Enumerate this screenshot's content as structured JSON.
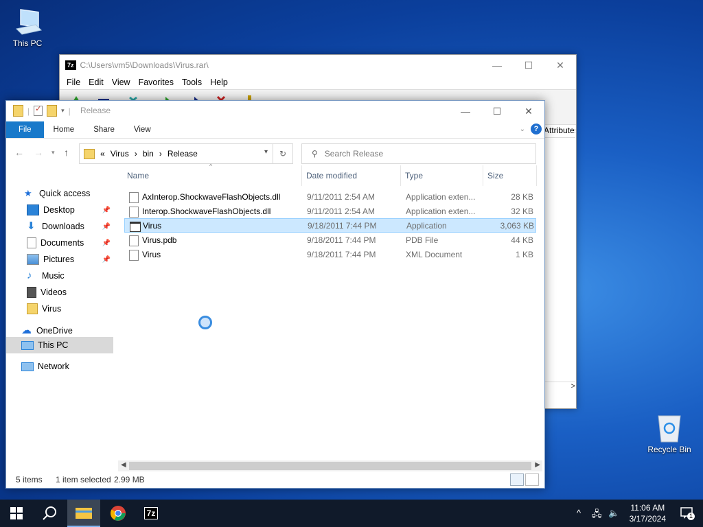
{
  "desktop": {
    "this_pc_label": "This PC",
    "recycle_bin_label": "Recycle Bin"
  },
  "sevenzip": {
    "path": "C:\\Users\\vm5\\Downloads\\Virus.rar\\",
    "logo": "7z",
    "menu": [
      "File",
      "Edit",
      "View",
      "Favorites",
      "Tools",
      "Help"
    ],
    "attr_header": "Attributes",
    "scroll_right": ">"
  },
  "explorer": {
    "title": "Release",
    "ribbon": {
      "file": "File",
      "home": "Home",
      "share": "Share",
      "view": "View"
    },
    "address": {
      "prefix": "«",
      "segments": [
        "Virus",
        "bin",
        "Release"
      ]
    },
    "search_placeholder": "Search Release",
    "nav": [
      {
        "label": "Quick access",
        "icon": "star-icon",
        "color": "#1e6fd9"
      },
      {
        "label": "Desktop",
        "icon": "desktop-icon",
        "pinned": true,
        "color": "#2b83d8"
      },
      {
        "label": "Downloads",
        "icon": "download-icon",
        "pinned": true,
        "color": "#2b83d8"
      },
      {
        "label": "Documents",
        "icon": "document-icon",
        "pinned": true,
        "color": "#8c8c8c"
      },
      {
        "label": "Pictures",
        "icon": "pictures-icon",
        "pinned": true,
        "color": "#4a8fd6"
      },
      {
        "label": "Music",
        "icon": "music-icon",
        "color": "#2b83d8"
      },
      {
        "label": "Videos",
        "icon": "videos-icon",
        "color": "#555555"
      },
      {
        "label": "Virus",
        "icon": "folder-icon",
        "color": "#f5d46b"
      },
      {
        "label": "OneDrive",
        "icon": "cloud-icon",
        "color": "#1e6fd9"
      },
      {
        "label": "This PC",
        "icon": "computer-icon",
        "selected": true,
        "color": "#2b83d8"
      },
      {
        "label": "Network",
        "icon": "network-icon",
        "color": "#2b83d8"
      }
    ],
    "columns": {
      "name": "Name",
      "date": "Date modified",
      "type": "Type",
      "size": "Size"
    },
    "files": [
      {
        "name": "AxInterop.ShockwaveFlashObjects.dll",
        "date": "9/11/2011 2:54 AM",
        "type": "Application exten...",
        "size": "28 KB",
        "icon": "dll-icon"
      },
      {
        "name": "Interop.ShockwaveFlashObjects.dll",
        "date": "9/11/2011 2:54 AM",
        "type": "Application exten...",
        "size": "32 KB",
        "icon": "dll-icon"
      },
      {
        "name": "Virus",
        "date": "9/18/2011 7:44 PM",
        "type": "Application",
        "size": "3,063 KB",
        "icon": "application-icon",
        "selected": true
      },
      {
        "name": "Virus.pdb",
        "date": "9/18/2011 7:44 PM",
        "type": "PDB File",
        "size": "44 KB",
        "icon": "file-icon"
      },
      {
        "name": "Virus",
        "date": "9/18/2011 7:44 PM",
        "type": "XML Document",
        "size": "1 KB",
        "icon": "xml-icon"
      }
    ],
    "status": {
      "count": "5 items",
      "selection": "1 item selected",
      "size": "2.99 MB"
    }
  },
  "taskbar": {
    "time": "11:06 AM",
    "date": "3/17/2024",
    "notification_count": "1",
    "sevenzip_label": "7z"
  }
}
